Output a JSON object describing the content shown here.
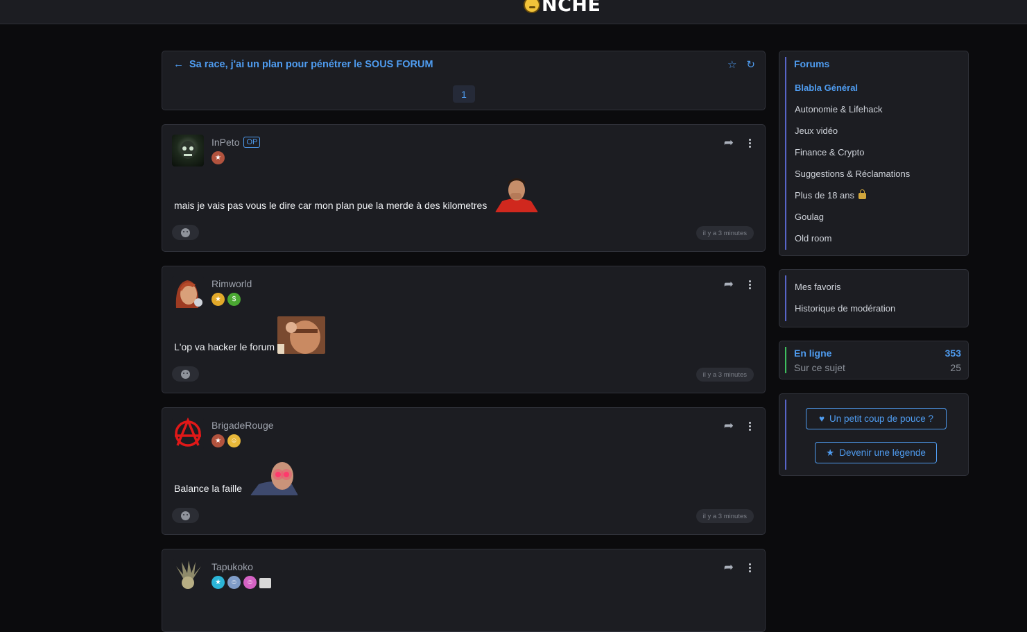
{
  "logo": {
    "text": "NCHE"
  },
  "topic": {
    "title": "Sa race, j'ai un plan pour pénétrer le SOUS FORUM",
    "current_page": "1"
  },
  "posts": [
    {
      "username": "InPeto",
      "op_label": "OP",
      "message": "mais je vais pas vous le dire car mon plan pue la merde à des kilometres",
      "time": "il y a 3 minutes"
    },
    {
      "username": "Rimworld",
      "message": "L'op va hacker le forum",
      "time": "il y a 3 minutes"
    },
    {
      "username": "BrigadeRouge",
      "message": "Balance la faille",
      "time": "il y a 3 minutes"
    },
    {
      "username": "Tapukoko"
    }
  ],
  "sidebar": {
    "forums_title": "Forums",
    "forums": [
      {
        "label": "Blabla Général",
        "active": true
      },
      {
        "label": "Autonomie & Lifehack"
      },
      {
        "label": "Jeux vidéo"
      },
      {
        "label": "Finance & Crypto"
      },
      {
        "label": "Suggestions & Réclamations"
      },
      {
        "label": "Plus de 18 ans"
      },
      {
        "label": "Goulag"
      },
      {
        "label": "Old room"
      }
    ],
    "links": [
      {
        "label": "Mes favoris"
      },
      {
        "label": "Historique de modération"
      }
    ],
    "online": {
      "title": "En ligne",
      "count": "353",
      "subject_label": "Sur ce sujet",
      "subject_count": "25"
    },
    "support": {
      "thumb_label": "Un petit coup de pouce ?",
      "legend_label": "Devenir une légende"
    }
  },
  "colors": {
    "accent": "#4f9cf0",
    "background": "#0b0b0d",
    "card": "#1c1d22",
    "online_bar": "#3fbf5f",
    "forums_bar": "#5865c9"
  }
}
